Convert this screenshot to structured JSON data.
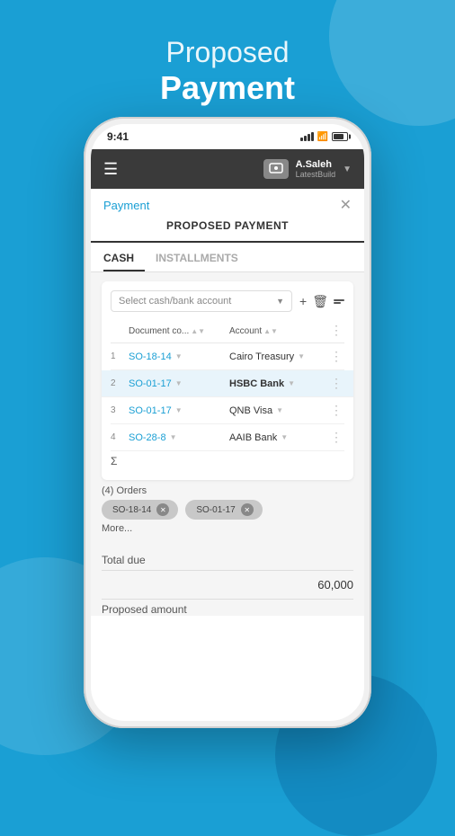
{
  "page": {
    "header_proposed": "Proposed",
    "header_payment": "Payment",
    "background_color": "#1a9fd4"
  },
  "status_bar": {
    "time": "9:41"
  },
  "app_bar": {
    "username": "A.Saleh",
    "build": "LatestBuild"
  },
  "payment_screen": {
    "back_link": "Payment",
    "title": "PROPOSED PAYMENT",
    "tabs": [
      {
        "label": "CASH",
        "active": true
      },
      {
        "label": "INSTALLMENTS",
        "active": false
      }
    ],
    "select_placeholder": "Select cash/bank account",
    "table": {
      "headers": {
        "document_col": "Document co...",
        "account_col": "Account"
      },
      "rows": [
        {
          "num": "1",
          "doc": "SO-18-14",
          "account": "Cairo Treasury",
          "highlighted": false
        },
        {
          "num": "2",
          "doc": "SO-01-17",
          "account": "HSBC Bank",
          "highlighted": true
        },
        {
          "num": "3",
          "doc": "SO-01-17",
          "account": "QNB Visa",
          "highlighted": false
        },
        {
          "num": "4",
          "doc": "SO-28-8",
          "account": "AAIB Bank",
          "highlighted": false
        }
      ],
      "sigma": "Σ"
    },
    "orders_count": "(4) Orders",
    "chips": [
      {
        "label": "SO-18-14"
      },
      {
        "label": "SO-01-17"
      }
    ],
    "more_label": "More...",
    "total_due_label": "Total due",
    "total_amount": "60,000",
    "proposed_amount_label": "Proposed amount"
  }
}
